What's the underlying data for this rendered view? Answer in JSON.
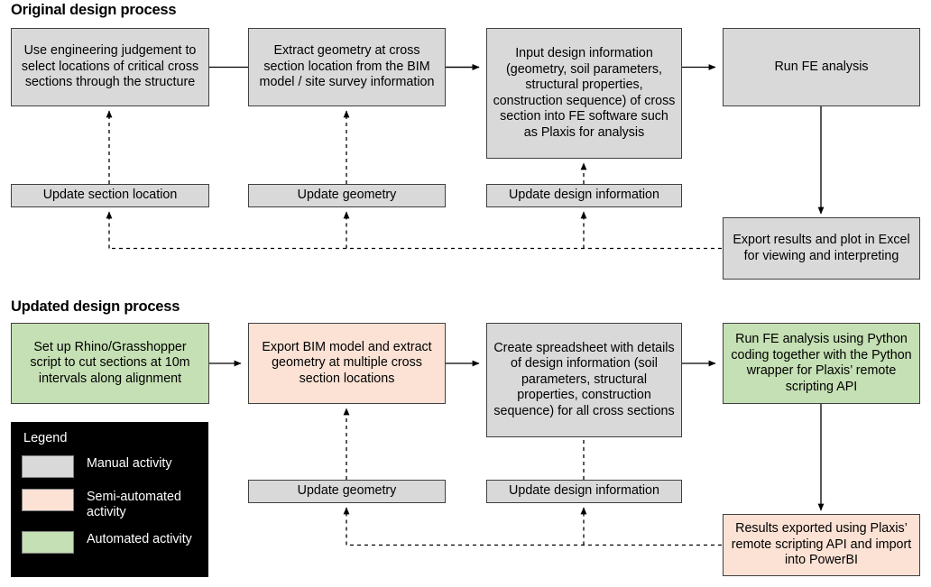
{
  "sections": {
    "original_title": "Original design process",
    "updated_title": "Updated design process"
  },
  "colors": {
    "manual": "#d9d9d9",
    "semi_automated": "#fbe2d5",
    "automated": "#c5e0b4",
    "border": "#404040",
    "legend_background": "#000000",
    "legend_text": "#ffffff",
    "arrow": "#000000"
  },
  "original_process": {
    "step1": "Use engineering judgement to select locations of critical cross sections through the structure",
    "step2": "Extract geometry at cross section location from the BIM model / site survey information",
    "step3": "Input  design information (geometry,  soil parameters, structural  properties, construction  sequence) of cross section into FE software such as Plaxis for analysis",
    "step4": "Run  FE analysis",
    "step5": "Export results and plot in Excel for viewing and interpreting",
    "update1": "Update section location",
    "update2": "Update geometry",
    "update3": "Update design information"
  },
  "updated_process": {
    "step1": "Set up  Rhino/Grasshopper script to cut sections at 10m intervals  along alignment",
    "step2": "Export BIM model and extract geometry at multiple cross section locations",
    "step3": "Create spreadsheet with details of design information (soil parameters, structural properties, construction sequence) for all cross sections",
    "step4": "Run  FE analysis using Python  coding together with the Python  wrapper for Plaxis’ remote scripting API",
    "step5": "Results  exported using Plaxis’ remote scripting API and import into PowerBI",
    "update2": "Update geometry",
    "update3": "Update design information"
  },
  "legend": {
    "title": "Legend",
    "items": [
      {
        "label": "Manual activity",
        "color": "#d9d9d9"
      },
      {
        "label": "Semi-automated\nactivity",
        "color": "#fbe2d5"
      },
      {
        "label": "Automated activity",
        "color": "#c5e0b4"
      }
    ]
  }
}
